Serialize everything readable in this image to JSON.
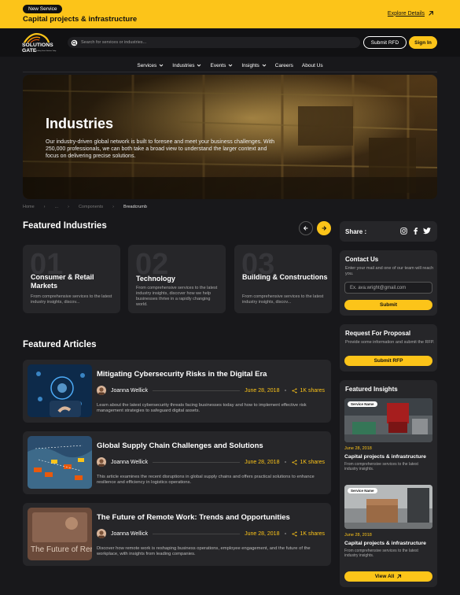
{
  "banner": {
    "tag": "New Service",
    "title": "Capital projects & infrastructure",
    "explore": "Explore Details"
  },
  "header": {
    "logo_main": "SOLUTIONS",
    "logo_main2": "GATE",
    "logo_sub": "Building Future Solutions Today",
    "search_placeholder": "Search for services or industries...",
    "submit_rfd": "Submit RFD",
    "sign_in": "Sign In"
  },
  "nav": [
    {
      "label": "Services",
      "dropdown": true
    },
    {
      "label": "Industries",
      "dropdown": true
    },
    {
      "label": "Events",
      "dropdown": true
    },
    {
      "label": "Insights",
      "dropdown": true
    },
    {
      "label": "Careers",
      "dropdown": false
    },
    {
      "label": "About Us",
      "dropdown": false
    }
  ],
  "hero": {
    "title": "Industries",
    "text": "Our industry-driven global network is built to foresee and meet your business challenges. With 250,000 professionals, we can both take a broad view to understand the larger context and focus on delivering precise solutions."
  },
  "breadcrumb": {
    "home": "Home",
    "sep": "...",
    "components": "Components",
    "current": "Breadcrumb"
  },
  "featured_industries": {
    "title": "Featured Industries",
    "items": [
      {
        "num": "01",
        "name": "Consumer & Retail Markets",
        "desc": "From comprehensive services to the latest industry insights, discov..."
      },
      {
        "num": "02",
        "name": "Technology",
        "desc": "From comprehensive services to the latest industry insights, discover how we help businesses thrive in a rapidly changing world."
      },
      {
        "num": "03",
        "name": "Building & Constructions",
        "desc": "From comprehensive services to the latest industry insights, discov..."
      }
    ]
  },
  "featured_articles": {
    "title": "Featured Articles",
    "items": [
      {
        "title": "Mitigating Cybersecurity Risks in the Digital Era",
        "author": "Joanna Wellick",
        "date": "June 28, 2018",
        "shares": "1K shares",
        "desc": "Learn about the latest cybersecurity threats facing businesses today and how to implement effective risk management strategies to safeguard digital assets."
      },
      {
        "title": "Global Supply Chain Challenges and Solutions",
        "author": "Joanna Wellick",
        "date": "June 28, 2018",
        "shares": "1K shares",
        "desc": "This article examines the recent disruptions in global supply chains and offers practical solutions to enhance resilience and efficiency in logistics operations."
      },
      {
        "title": "The Future of Remote Work: Trends and Opportunities",
        "author": "Joanna Wellick",
        "date": "June 28, 2018",
        "shares": "1K shares",
        "desc": "Discover how remote work is reshaping business operations, employee engagement, and the future of the workplace, with insights from leading companies.",
        "thumb_text": "The Future of Remote Wor"
      }
    ]
  },
  "share": {
    "label": "Share :"
  },
  "contact": {
    "title": "Contact Us",
    "desc": "Enter your mail and one of our team will reach you.",
    "email_placeholder": "Ex. ava.wright@gmail.com",
    "submit": "Submit"
  },
  "rfp": {
    "title": "Request For Proposal",
    "desc": "Provide some information and submit the RFP.",
    "submit": "Submit RFP"
  },
  "insights": {
    "title": "Featured Insights",
    "items": [
      {
        "badge": "Service Name",
        "date": "June 28, 2018",
        "title": "Capital projects & infrastructure",
        "desc": "From comprehensive services to the latest industry insights."
      },
      {
        "badge": "Service Name",
        "date": "June 28, 2018",
        "title": "Capital projects & infrastructure",
        "desc": "From comprehensive services to the latest industry insights."
      }
    ],
    "view_all": "View All"
  },
  "colors": {
    "accent": "#fcc419",
    "background": "#18181b",
    "card": "#262629"
  },
  "icons": [
    "arrow-up-right-icon",
    "search-icon",
    "chevron-down-icon",
    "arrow-left-icon",
    "arrow-right-icon",
    "share-icon",
    "instagram-icon",
    "facebook-icon",
    "twitter-icon"
  ]
}
